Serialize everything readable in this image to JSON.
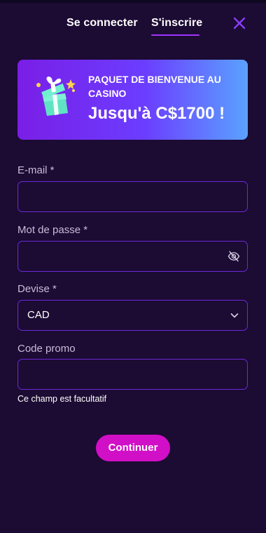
{
  "tabs": {
    "login_label": "Se connecter",
    "register_label": "S'inscrire"
  },
  "banner": {
    "title": "PAQUET DE BIENVENUE AU CASINO",
    "amount": "Jusqu'à C$1700 !"
  },
  "form": {
    "email_label": "E-mail *",
    "email_value": "",
    "password_label": "Mot de passe *",
    "password_value": "",
    "currency_label": "Devise *",
    "currency_value": "CAD",
    "promo_label": "Code promo",
    "promo_value": "",
    "promo_hint": "Ce champ est facultatif",
    "submit_label": "Continuer"
  },
  "colors": {
    "background": "#1c0b33",
    "accent": "#a233ff",
    "field_border": "#6a2bd6",
    "button": "#d10fc7"
  },
  "icons": {
    "close": "close-icon",
    "password_visibility": "eye-off-icon",
    "currency_dropdown": "chevron-down-icon",
    "banner": "gift-box-icon"
  }
}
